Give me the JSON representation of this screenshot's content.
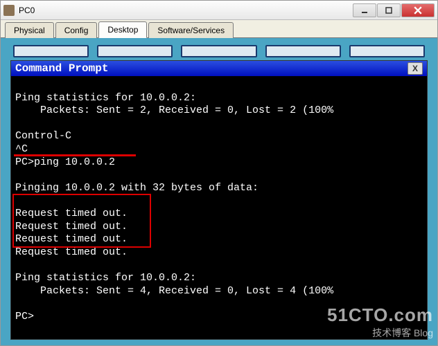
{
  "window": {
    "title": "PC0"
  },
  "tabs": {
    "physical": "Physical",
    "config": "Config",
    "desktop": "Desktop",
    "software": "Software/Services",
    "active": "desktop"
  },
  "prompt": {
    "title": "Command Prompt",
    "close_label": "X"
  },
  "terminal": {
    "lines": [
      "Ping statistics for 10.0.0.2:",
      "    Packets: Sent = 2, Received = 0, Lost = 2 (100% ",
      "",
      "Control-C",
      "^C",
      "PC>ping 10.0.0.2",
      "",
      "Pinging 10.0.0.2 with 32 bytes of data:",
      "",
      "Request timed out.",
      "Request timed out.",
      "Request timed out.",
      "Request timed out.",
      "",
      "Ping statistics for 10.0.0.2:",
      "    Packets: Sent = 4, Received = 0, Lost = 4 (100%",
      "",
      "PC>"
    ]
  },
  "watermark": {
    "line1": "51CTO.com",
    "line2": "技术博客  Blog"
  }
}
